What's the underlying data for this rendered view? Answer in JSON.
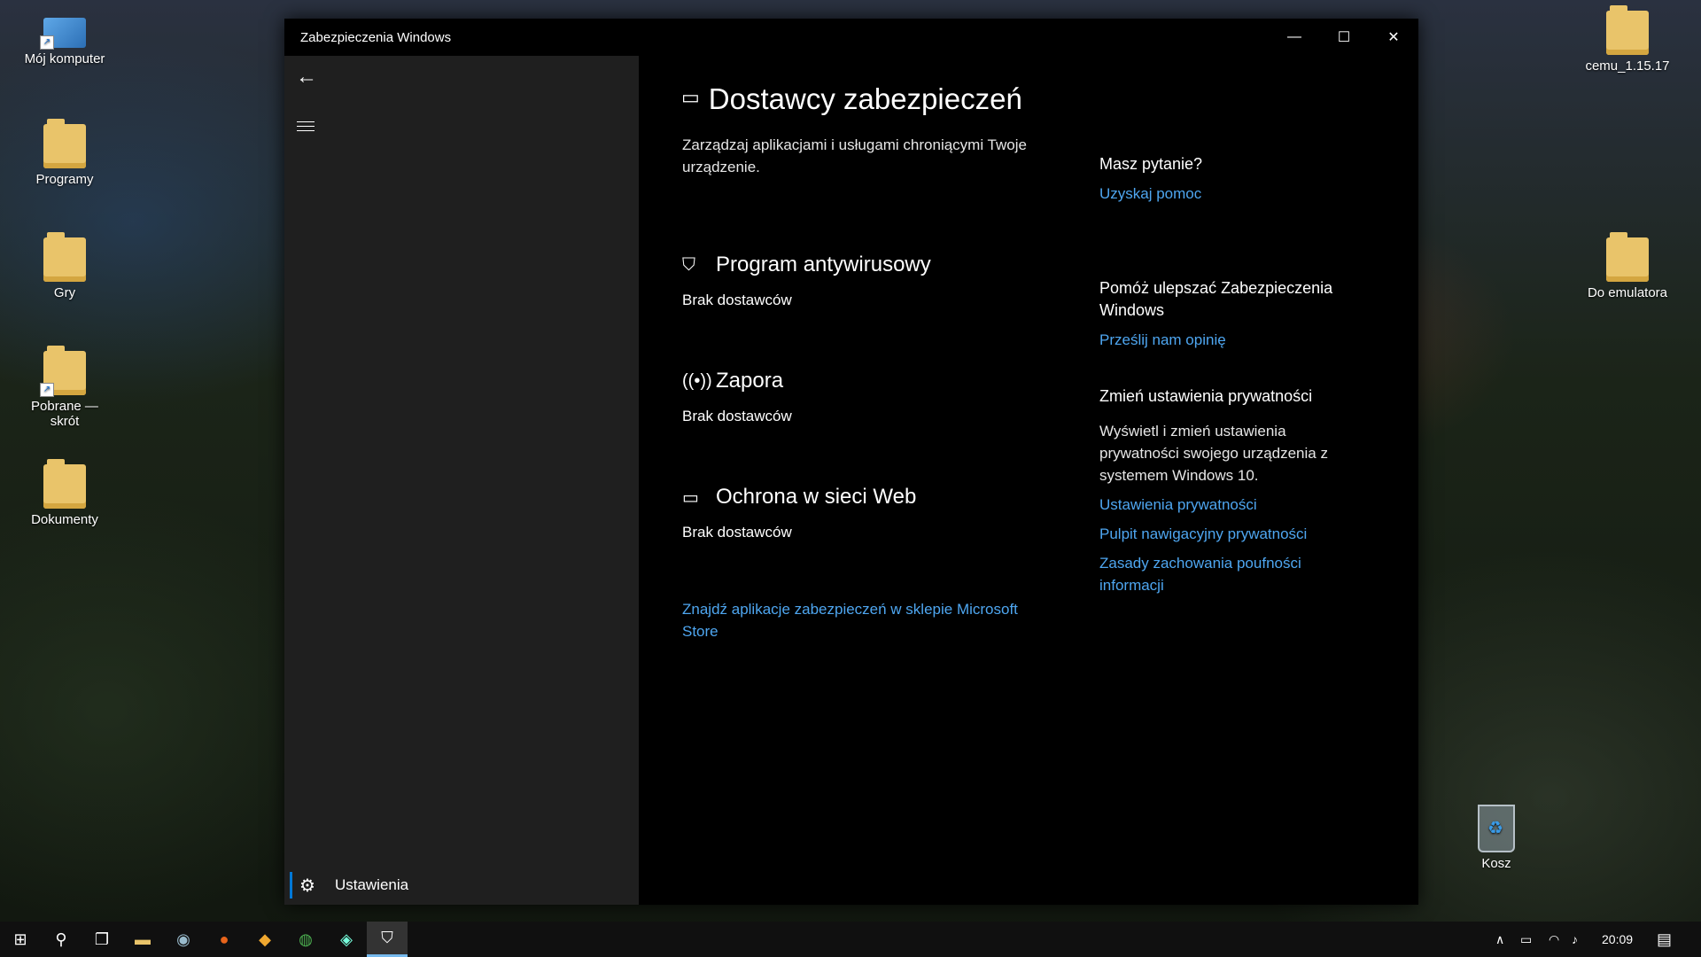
{
  "desktop": {
    "icons": [
      {
        "label": "Mój komputer"
      },
      {
        "label": "Programy"
      },
      {
        "label": "Gry"
      },
      {
        "label": "Pobrane — skrót"
      },
      {
        "label": "Dokumenty"
      },
      {
        "label": "cemu_1.15.17"
      },
      {
        "label": "Do emulatora"
      },
      {
        "label": "Kosz"
      }
    ]
  },
  "window": {
    "title": "Zabezpieczenia Windows",
    "minimize": "—",
    "maximize": "☐",
    "close": "✕"
  },
  "sidebar": {
    "back_icon": "←",
    "settings_label": "Ustawienia",
    "gear_icon": "⚙"
  },
  "main": {
    "title": "Dostawcy zabezpieczeń",
    "description": "Zarządzaj aplikacjami i usługami chroniącymi Twoje urządzenie.",
    "sections": [
      {
        "title": "Program antywirusowy",
        "status": "Brak dostawców"
      },
      {
        "title": "Zapora",
        "status": "Brak dostawców"
      },
      {
        "title": "Ochrona w sieci Web",
        "status": "Brak dostawców"
      }
    ],
    "store_link": "Znajdź aplikacje zabezpieczeń w sklepie Microsoft Store"
  },
  "right": {
    "question_heading": "Masz pytanie?",
    "help_link": "Uzyskaj pomoc",
    "improve_heading": "Pomóż ulepszać Zabezpieczenia Windows",
    "feedback_link": "Prześlij nam opinię",
    "privacy_heading": "Zmień ustawienia prywatności",
    "privacy_text": "Wyświetl i zmień ustawienia prywatności swojego urządzenia z systemem Windows 10.",
    "privacy_links": [
      "Ustawienia prywatności",
      "Pulpit nawigacyjny prywatności",
      "Zasady zachowania poufności informacji"
    ]
  },
  "taskbar": {
    "clock": "20:09",
    "accent_color": "#0078d7",
    "link_color": "#4ea6f0"
  }
}
